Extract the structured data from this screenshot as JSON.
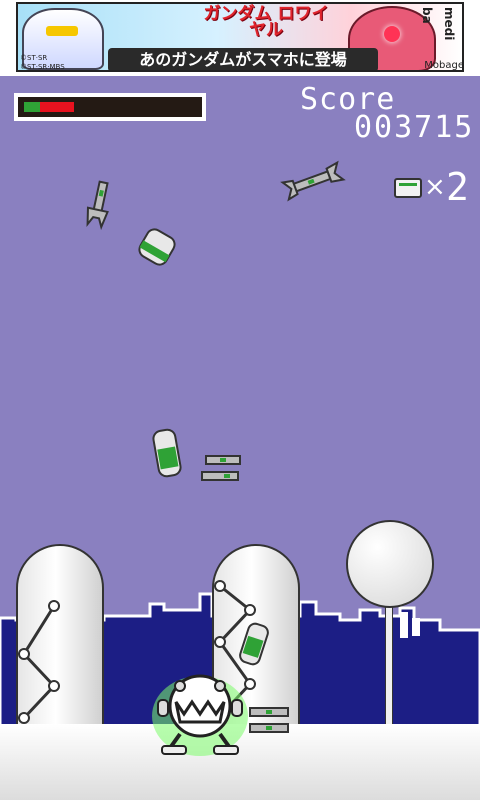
{
  "ad": {
    "logo_text": "ガンダム ロワイヤル",
    "tagline": "あのガンダムがスマホに登場",
    "copyright_1": "©ST·SR",
    "copyright_2": "©ST·SR·MBS",
    "brand": "medi ba",
    "mobage": "Mobage"
  },
  "hud": {
    "health_fraction": 0.22,
    "score_label": "Score",
    "score_value": "003715",
    "lives_multiplier": "×",
    "lives_count": "2",
    "lives_icon": "battery-pack-icon"
  },
  "scene": {
    "sky_color": "#8a80c0",
    "skyline_color": "#1c1e85",
    "ground_color": "#ffffff",
    "falling_items": [
      {
        "kind": "wrench"
      },
      {
        "kind": "wrench"
      },
      {
        "kind": "battery"
      },
      {
        "kind": "battery"
      },
      {
        "kind": "wrench"
      },
      {
        "kind": "battery"
      },
      {
        "kind": "wrench"
      }
    ],
    "player": "robot-catcher"
  }
}
